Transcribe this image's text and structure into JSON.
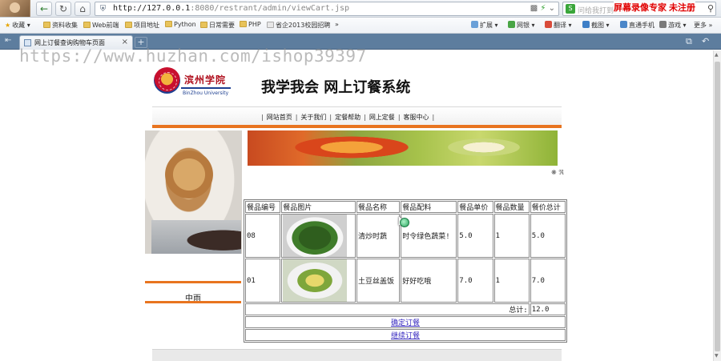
{
  "browser": {
    "url_host": "http://127.0.0.1",
    "url_rest": ":8080/restrant/admin/viewCart.jsp",
    "search_placeholder": "问给我打到超拍",
    "recorder_text": "屏幕录像专家 未注册",
    "bookmarks": [
      "收藏",
      "资料收集",
      "Web前端",
      "项目地址",
      "Python",
      "日常需要",
      "PHP",
      "省企2013校园招聘"
    ],
    "more": "»",
    "tools": [
      "扩展",
      "网银",
      "翻译",
      "截图",
      "直通手机",
      "游戏",
      "更多"
    ],
    "tab_title": "网上订餐查询购物车页面",
    "tab_close": "×",
    "new_tab": "+"
  },
  "watermark": "https://www.huzhan.com/ishop39397",
  "site": {
    "title": "我学我会 网上订餐系统",
    "nav": [
      "网站首页",
      "关于我们",
      "定餐帮助",
      "网上定餐",
      "客服中心"
    ],
    "user_name": "中雨"
  },
  "cart": {
    "headers": [
      "餐品编号",
      "餐品图片",
      "餐品名称",
      "餐品配料",
      "餐品单价",
      "餐品数量",
      "餐价总计"
    ],
    "rows": [
      {
        "id": "08",
        "image": "spinach-dish",
        "name": "清炒时蔬",
        "ingredients": "时令绿色蔬菜!",
        "price": "5.0",
        "qty": "1",
        "total": "5.0"
      },
      {
        "id": "01",
        "image": "potato-rice-dish",
        "name": "土豆丝盖饭",
        "ingredients": "好好吃哦",
        "price": "7.0",
        "qty": "1",
        "total": "7.0"
      }
    ],
    "total_label": "总计:",
    "total_value": "12.0",
    "confirm_label": "确定订餐",
    "continue_label": "继续订餐"
  }
}
